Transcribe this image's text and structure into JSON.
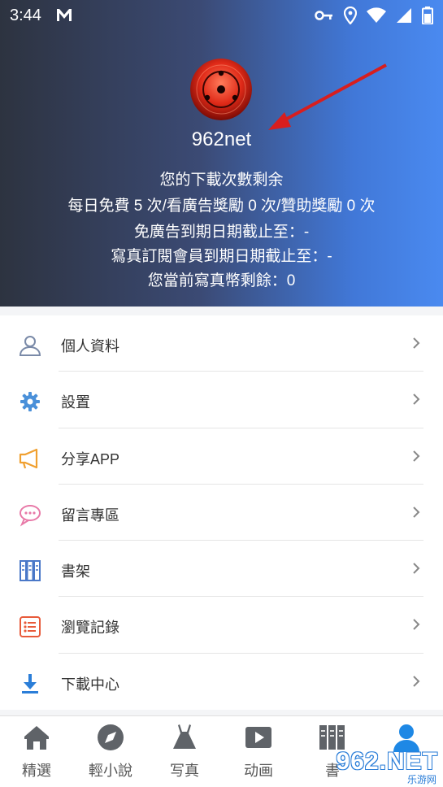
{
  "status_bar": {
    "time": "3:44"
  },
  "profile": {
    "username": "962net",
    "lines": [
      "您的下載次數剩余",
      "每日免費 5 次/看廣告獎勵 0 次/贊助獎勵 0 次",
      "免廣告到期日期截止至：-",
      "寫真訂閱會員到期日期截止至：-",
      "您當前寫真幣剩餘：0"
    ]
  },
  "menu": {
    "items": [
      {
        "label": "個人資料",
        "icon": "user-icon"
      },
      {
        "label": "設置",
        "icon": "gear-icon"
      },
      {
        "label": "分享APP",
        "icon": "megaphone-icon"
      },
      {
        "label": "留言專區",
        "icon": "chat-icon"
      },
      {
        "label": "書架",
        "icon": "bookshelf-icon"
      },
      {
        "label": "瀏覽記錄",
        "icon": "history-icon"
      },
      {
        "label": "下載中心",
        "icon": "download-icon"
      }
    ]
  },
  "tabs": [
    {
      "label": "精選",
      "icon": "home-icon"
    },
    {
      "label": "輕小說",
      "icon": "compass-icon"
    },
    {
      "label": "写真",
      "icon": "dress-icon"
    },
    {
      "label": "动画",
      "icon": "play-icon"
    },
    {
      "label": "書",
      "icon": "books-icon"
    },
    {
      "label": "",
      "icon": "person-icon",
      "active": true
    }
  ],
  "colors": {
    "accent": "#1e88e5",
    "tab_inactive": "#5f6368"
  },
  "watermark": {
    "text": "962.NET",
    "sub": "乐游网"
  }
}
